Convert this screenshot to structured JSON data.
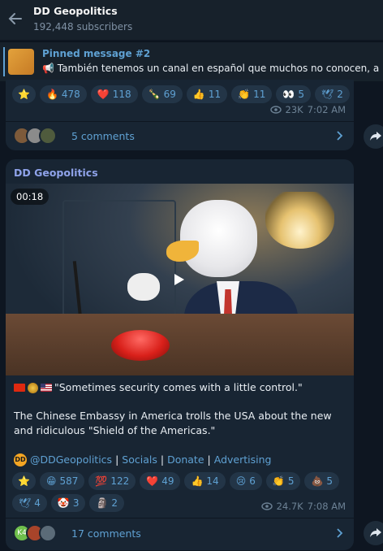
{
  "header": {
    "title": "DD Geopolitics",
    "subtitle": "192,448 subscribers"
  },
  "pinned": {
    "title": "Pinned message #2",
    "text": "También tenemos un canal en español que muchos no conocen, a"
  },
  "post1": {
    "reactions": [
      {
        "icon": "star-icon",
        "glyph": "⭐",
        "count": ""
      },
      {
        "icon": "fire-icon",
        "glyph": "🔥",
        "count": "478"
      },
      {
        "icon": "heart-icon",
        "glyph": "❤️",
        "count": "118"
      },
      {
        "icon": "bottle-icon",
        "glyph": "🍾",
        "count": "69"
      },
      {
        "icon": "thumbs-up-icon",
        "glyph": "👍",
        "count": "11"
      },
      {
        "icon": "clap-icon",
        "glyph": "👏",
        "count": "11"
      },
      {
        "icon": "eyes-icon",
        "glyph": "👀",
        "count": "5"
      },
      {
        "icon": "dove-icon",
        "glyph": "🕊",
        "count": "2"
      }
    ],
    "views": "23K",
    "time": "7:02 AM",
    "comments": "5 comments"
  },
  "post2": {
    "channel": "DD Geopolitics",
    "duration": "00:18",
    "quote": "\"Sometimes security comes with a little control.\"",
    "body": "The Chinese Embassy in America trolls the USA about the new and ridiculous \"Shield of the Americas.\"",
    "links": {
      "handle": "@DDGeopolitics",
      "socials": "Socials",
      "donate": "Donate",
      "advertising": "Advertising",
      "separator": "|"
    },
    "reactions": [
      {
        "icon": "star-icon",
        "glyph": "⭐",
        "count": ""
      },
      {
        "icon": "grin-icon",
        "glyph": "😁",
        "count": "587"
      },
      {
        "icon": "hundred-icon",
        "glyph": "💯",
        "count": "122"
      },
      {
        "icon": "heart-icon",
        "glyph": "❤️",
        "count": "49"
      },
      {
        "icon": "thumbs-up-icon",
        "glyph": "👍",
        "count": "14"
      },
      {
        "icon": "cry-icon",
        "glyph": "😢",
        "count": "6"
      },
      {
        "icon": "clap-icon",
        "glyph": "👏",
        "count": "5"
      },
      {
        "icon": "poop-icon",
        "glyph": "💩",
        "count": "5"
      },
      {
        "icon": "dove-icon",
        "glyph": "🕊",
        "count": "4"
      },
      {
        "icon": "clown-icon",
        "glyph": "🤡",
        "count": "3"
      },
      {
        "icon": "moai-icon",
        "glyph": "🗿",
        "count": "2"
      }
    ],
    "views": "24.7K",
    "time": "7:08 AM",
    "comments": "17 comments",
    "avatar_initials": "K4"
  },
  "colors": {
    "background": "#0e1621",
    "bubble": "#182533",
    "accent": "#5fa1d3"
  }
}
